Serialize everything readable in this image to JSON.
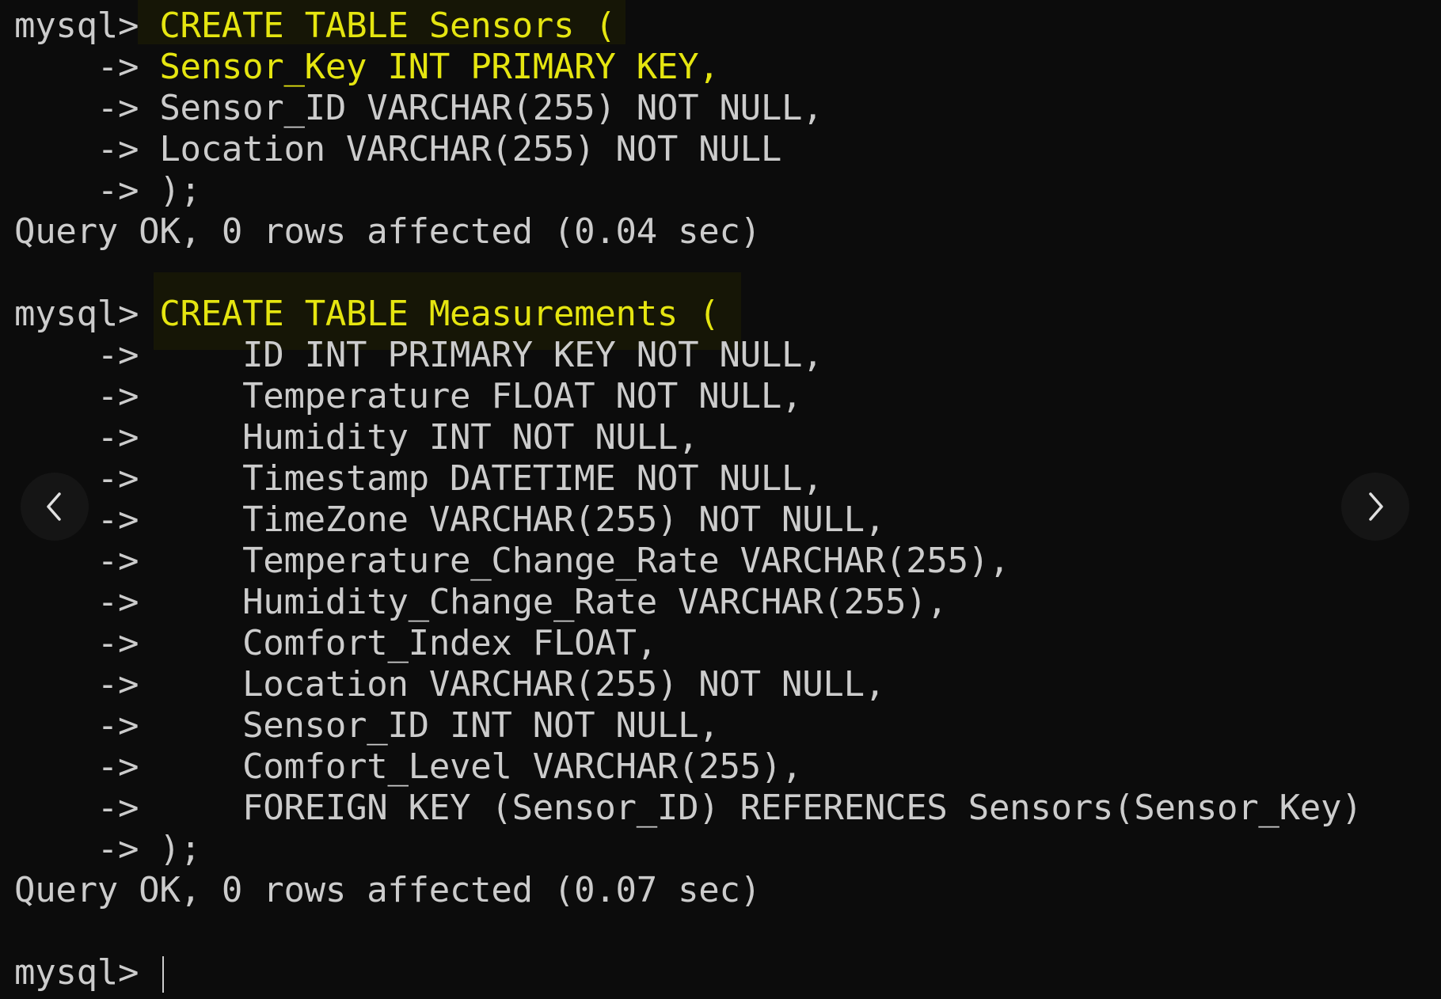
{
  "terminal": {
    "prompt": "mysql>",
    "cont": "    ->",
    "block1": {
      "head": "CREATE TABLE Sensors (",
      "l1": " Sensor_Key INT PRIMARY KEY,",
      "l2": " Sensor_ID VARCHAR(255) NOT NULL,",
      "l3": " Location VARCHAR(255) NOT NULL",
      "end": " );",
      "result": "Query OK, 0 rows affected (0.04 sec)"
    },
    "block2": {
      "head": "CREATE TABLE Measurements (",
      "l1": "     ID INT PRIMARY KEY NOT NULL,",
      "l2": "     Temperature FLOAT NOT NULL,",
      "l3": "     Humidity INT NOT NULL,",
      "l4": "     Timestamp DATETIME NOT NULL,",
      "l5": "     TimeZone VARCHAR(255) NOT NULL,",
      "l6": "     Temperature_Change_Rate VARCHAR(255),",
      "l7": "     Humidity_Change_Rate VARCHAR(255),",
      "l8": "     Comfort_Index FLOAT,",
      "l9": "     Location VARCHAR(255) NOT NULL,",
      "l10": "     Sensor_ID INT NOT NULL,",
      "l11": "     Comfort_Level VARCHAR(255),",
      "l12": "     FOREIGN KEY (Sensor_ID) REFERENCES Sensors(Sensor_Key)",
      "end": " );",
      "result": "Query OK, 0 rows affected (0.07 sec)"
    }
  },
  "nav": {
    "prev_icon": "chevron-left-icon",
    "next_icon": "chevron-right-icon"
  },
  "colors": {
    "background": "#0c0c0c",
    "text": "#cccccc",
    "highlight": "#e5e510"
  }
}
